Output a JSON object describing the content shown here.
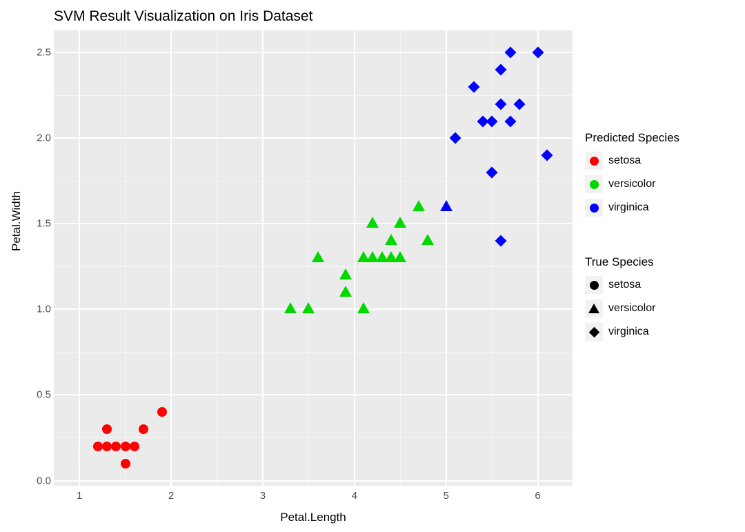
{
  "chart_data": {
    "type": "scatter",
    "title": "SVM Result Visualization on Iris Dataset",
    "xlabel": "Petal.Length",
    "ylabel": "Petal.Width",
    "xlim": [
      0.72,
      6.38
    ],
    "ylim": [
      -0.03,
      2.63
    ],
    "x_ticks": [
      1,
      2,
      3,
      4,
      5,
      6
    ],
    "y_ticks": [
      0.0,
      0.5,
      1.0,
      1.5,
      2.0,
      2.5
    ],
    "legend_color": {
      "title": "Predicted Species",
      "items": [
        {
          "label": "setosa",
          "color": "#ff0000"
        },
        {
          "label": "versicolor",
          "color": "#00d800"
        },
        {
          "label": "virginica",
          "color": "#0000ff"
        }
      ]
    },
    "legend_shape": {
      "title": "True Species",
      "items": [
        {
          "label": "setosa",
          "shape": "circle"
        },
        {
          "label": "versicolor",
          "shape": "triangle"
        },
        {
          "label": "virginica",
          "shape": "diamond"
        }
      ]
    },
    "series": [
      {
        "x": 1.2,
        "y": 0.2,
        "color": "setosa",
        "shape": "setosa"
      },
      {
        "x": 1.3,
        "y": 0.2,
        "color": "setosa",
        "shape": "setosa"
      },
      {
        "x": 1.3,
        "y": 0.3,
        "color": "setosa",
        "shape": "setosa"
      },
      {
        "x": 1.4,
        "y": 0.2,
        "color": "setosa",
        "shape": "setosa"
      },
      {
        "x": 1.5,
        "y": 0.2,
        "color": "setosa",
        "shape": "setosa"
      },
      {
        "x": 1.6,
        "y": 0.2,
        "color": "setosa",
        "shape": "setosa"
      },
      {
        "x": 1.5,
        "y": 0.1,
        "color": "setosa",
        "shape": "setosa"
      },
      {
        "x": 1.7,
        "y": 0.3,
        "color": "setosa",
        "shape": "setosa"
      },
      {
        "x": 1.9,
        "y": 0.4,
        "color": "setosa",
        "shape": "setosa"
      },
      {
        "x": 3.3,
        "y": 1.0,
        "color": "versicolor",
        "shape": "versicolor"
      },
      {
        "x": 3.5,
        "y": 1.0,
        "color": "versicolor",
        "shape": "versicolor"
      },
      {
        "x": 3.6,
        "y": 1.3,
        "color": "versicolor",
        "shape": "versicolor"
      },
      {
        "x": 3.9,
        "y": 1.1,
        "color": "versicolor",
        "shape": "versicolor"
      },
      {
        "x": 3.9,
        "y": 1.2,
        "color": "versicolor",
        "shape": "versicolor"
      },
      {
        "x": 4.1,
        "y": 1.0,
        "color": "versicolor",
        "shape": "versicolor"
      },
      {
        "x": 4.1,
        "y": 1.3,
        "color": "versicolor",
        "shape": "versicolor"
      },
      {
        "x": 4.2,
        "y": 1.3,
        "color": "versicolor",
        "shape": "versicolor"
      },
      {
        "x": 4.2,
        "y": 1.5,
        "color": "versicolor",
        "shape": "versicolor"
      },
      {
        "x": 4.3,
        "y": 1.3,
        "color": "versicolor",
        "shape": "versicolor"
      },
      {
        "x": 4.4,
        "y": 1.3,
        "color": "versicolor",
        "shape": "versicolor"
      },
      {
        "x": 4.4,
        "y": 1.4,
        "color": "versicolor",
        "shape": "versicolor"
      },
      {
        "x": 4.5,
        "y": 1.3,
        "color": "versicolor",
        "shape": "versicolor"
      },
      {
        "x": 4.5,
        "y": 1.5,
        "color": "versicolor",
        "shape": "versicolor"
      },
      {
        "x": 4.7,
        "y": 1.6,
        "color": "versicolor",
        "shape": "versicolor"
      },
      {
        "x": 4.8,
        "y": 1.4,
        "color": "versicolor",
        "shape": "versicolor"
      },
      {
        "x": 5.0,
        "y": 1.6,
        "color": "virginica",
        "shape": "versicolor"
      },
      {
        "x": 5.1,
        "y": 2.0,
        "color": "virginica",
        "shape": "virginica"
      },
      {
        "x": 5.3,
        "y": 2.3,
        "color": "virginica",
        "shape": "virginica"
      },
      {
        "x": 5.4,
        "y": 2.1,
        "color": "virginica",
        "shape": "virginica"
      },
      {
        "x": 5.5,
        "y": 2.1,
        "color": "virginica",
        "shape": "virginica"
      },
      {
        "x": 5.5,
        "y": 1.8,
        "color": "virginica",
        "shape": "virginica"
      },
      {
        "x": 5.6,
        "y": 2.4,
        "color": "virginica",
        "shape": "virginica"
      },
      {
        "x": 5.6,
        "y": 2.2,
        "color": "virginica",
        "shape": "virginica"
      },
      {
        "x": 5.6,
        "y": 1.4,
        "color": "virginica",
        "shape": "virginica"
      },
      {
        "x": 5.7,
        "y": 2.5,
        "color": "virginica",
        "shape": "virginica"
      },
      {
        "x": 5.7,
        "y": 2.1,
        "color": "virginica",
        "shape": "virginica"
      },
      {
        "x": 5.8,
        "y": 2.2,
        "color": "virginica",
        "shape": "virginica"
      },
      {
        "x": 6.0,
        "y": 2.5,
        "color": "virginica",
        "shape": "virginica"
      },
      {
        "x": 6.1,
        "y": 1.9,
        "color": "virginica",
        "shape": "virginica"
      }
    ]
  }
}
